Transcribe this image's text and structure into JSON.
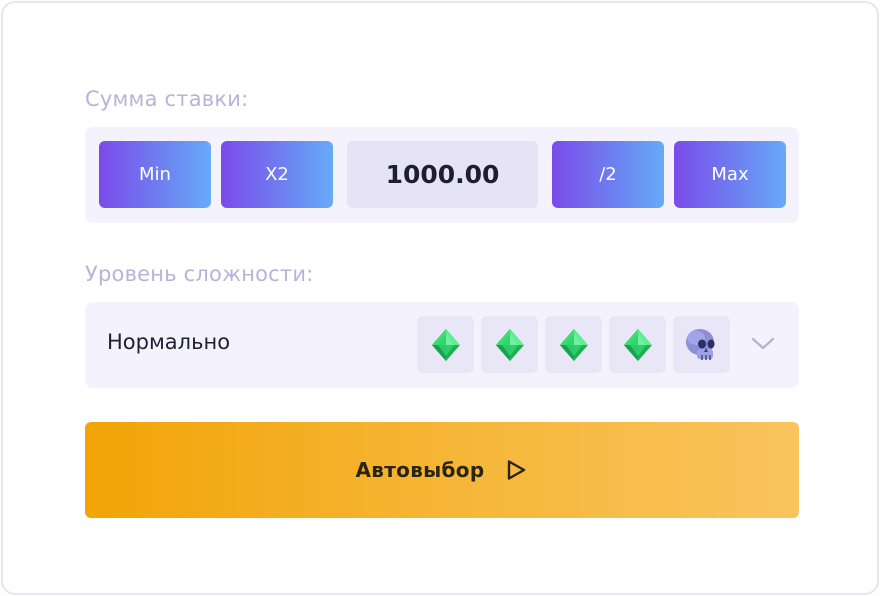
{
  "bet": {
    "label": "Сумма ставки:",
    "amount": "1000.00",
    "buttons": {
      "min": "Min",
      "double": "X2",
      "half": "/2",
      "max": "Max"
    }
  },
  "difficulty": {
    "label": "Уровень сложности:",
    "value": "Нормально",
    "tiles": [
      "diamond-icon",
      "diamond-icon",
      "diamond-icon",
      "diamond-icon",
      "skull-icon"
    ]
  },
  "autoselect": {
    "label": "Автовыбор",
    "icon": "play-icon"
  },
  "colors": {
    "accent_gradient_start": "#7b4bea",
    "accent_gradient_end": "#67aaf8",
    "primary_button_start": "#f2a407",
    "primary_button_end": "#f9c45d",
    "label_color": "#b6b4d8",
    "gem_color": "#27d068"
  }
}
